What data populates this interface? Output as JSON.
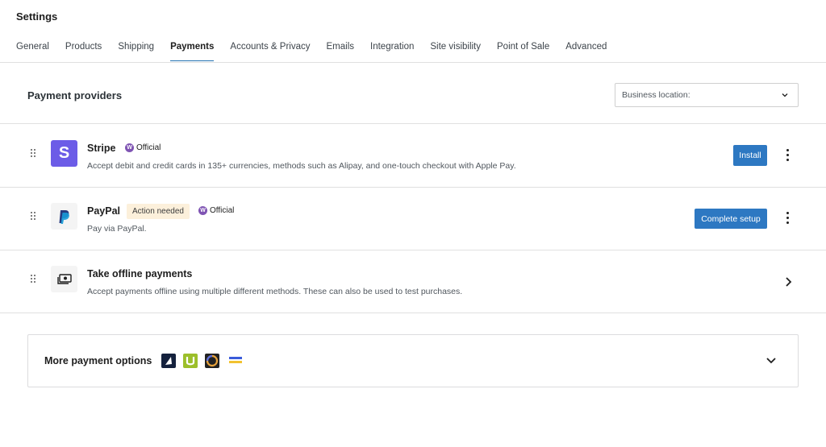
{
  "header": {
    "title": "Settings",
    "tabs": [
      {
        "label": "General"
      },
      {
        "label": "Products"
      },
      {
        "label": "Shipping"
      },
      {
        "label": "Payments"
      },
      {
        "label": "Accounts & Privacy"
      },
      {
        "label": "Emails"
      },
      {
        "label": "Integration"
      },
      {
        "label": "Site visibility"
      },
      {
        "label": "Point of Sale"
      },
      {
        "label": "Advanced"
      }
    ],
    "active_tab": "Payments"
  },
  "section": {
    "title": "Payment providers",
    "location_select": {
      "value": "Business location:"
    }
  },
  "providers": [
    {
      "name": "Stripe",
      "logo_letter": "S",
      "badge": "Official",
      "description": "Accept debit and credit cards in 135+ currencies, methods such as Alipay, and one-touch checkout with Apple Pay.",
      "action_label": "Install"
    },
    {
      "name": "PayPal",
      "status_badge": "Action needed",
      "badge": "Official",
      "description": "Pay via PayPal.",
      "action_label": "Complete setup"
    },
    {
      "name": "Take offline payments",
      "description": "Accept payments offline using multiple different methods. These can also be used to test purchases."
    }
  ],
  "more": {
    "title": "More payment options",
    "logos": [
      "airwallex-logo-icon",
      "u-logo-icon",
      "ring-logo-icon",
      "flag-stripes-logo-icon"
    ]
  },
  "colors": {
    "accent": "#2d78c2",
    "stripe": "#6c5ce7",
    "official": "#7f54b3",
    "action_badge_bg": "#fcf0db"
  }
}
